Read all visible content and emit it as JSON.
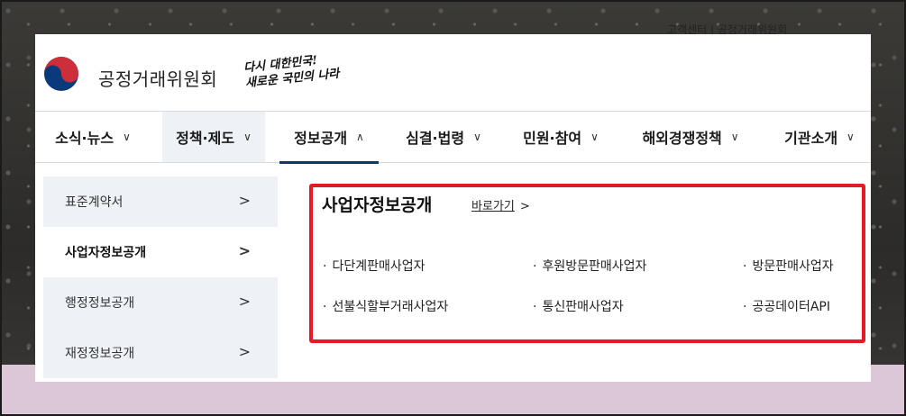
{
  "top_strip": "고객센터 | 공정거래위원회",
  "header": {
    "org_name": "공정거래위원회",
    "slogan_line1": "다시 대한민국!",
    "slogan_line2": "새로운 국민의 나라"
  },
  "nav": [
    {
      "label": "소식·뉴스",
      "chevron": "∨"
    },
    {
      "label": "정책·제도",
      "chevron": "∨"
    },
    {
      "label": "정보공개",
      "chevron": "∧"
    },
    {
      "label": "심결·법령",
      "chevron": "∨"
    },
    {
      "label": "민원·참여",
      "chevron": "∨"
    },
    {
      "label": "해외경쟁정책",
      "chevron": "∨"
    },
    {
      "label": "기관소개",
      "chevron": "∨"
    }
  ],
  "sidebar": [
    {
      "label": "표준계약서",
      "arrow": ">"
    },
    {
      "label": "사업자정보공개",
      "arrow": ">"
    },
    {
      "label": "행정정보공개",
      "arrow": ">"
    },
    {
      "label": "재정정보공개",
      "arrow": ">"
    }
  ],
  "content": {
    "title": "사업자정보공개",
    "go_link": "바로가기",
    "go_arrow": ">",
    "links": [
      "다단계판매사업자",
      "후원방문판매사업자",
      "방문판매사업자",
      "선불식할부거래사업자",
      "통신판매사업자",
      "공공데이터API"
    ]
  },
  "colors": {
    "nav_active_underline": "#0c3a6e",
    "highlight_bg": "#eef1f5",
    "annotation_red": "#e31c23"
  },
  "icons": {
    "logo": "taegeuk-logo-icon",
    "chevron": "chevron-down-icon",
    "arrow": "chevron-right-icon"
  }
}
